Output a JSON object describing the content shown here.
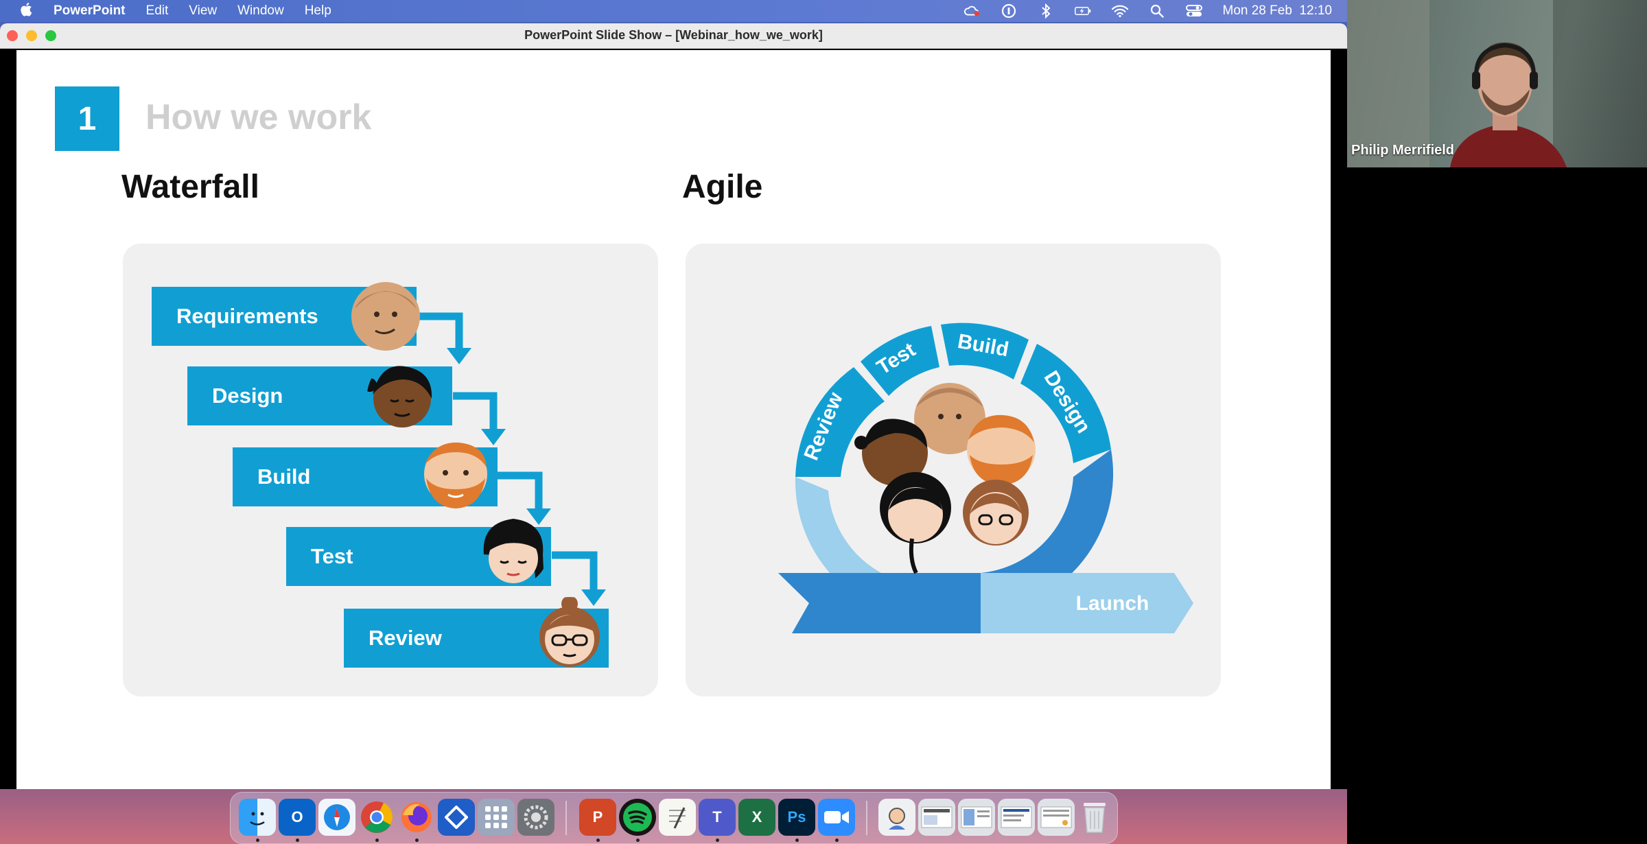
{
  "menubar": {
    "app_name": "PowerPoint",
    "menus": [
      "Edit",
      "View",
      "Window",
      "Help"
    ],
    "clock": "Mon 28 Feb  12:10",
    "status_icons": [
      "creative-cloud-icon",
      "1password-icon",
      "bluetooth-icon",
      "battery-icon",
      "wifi-icon",
      "search-icon",
      "control-center-icon"
    ]
  },
  "window": {
    "title": "PowerPoint Slide Show – [Webinar_how_we_work]"
  },
  "slide": {
    "section_number": "1",
    "title": "How we work",
    "waterfall": {
      "heading": "Waterfall",
      "steps": [
        "Requirements",
        "Design",
        "Build",
        "Test",
        "Review"
      ]
    },
    "agile": {
      "heading": "Agile",
      "cycle": [
        "Review",
        "Test",
        "Build",
        "Design"
      ],
      "launch": "Launch"
    }
  },
  "video": {
    "participant_name": "Philip Merrifield"
  },
  "dock": {
    "apps": [
      "finder-icon",
      "outlook-icon",
      "safari-icon",
      "chrome-icon",
      "firefox-icon",
      "jira-icon",
      "launchpad-icon",
      "system-preferences-icon",
      "powerpoint-icon",
      "spotify-icon",
      "textedit-icon",
      "teams-icon",
      "excel-icon",
      "photoshop-icon",
      "zoom-icon",
      "preview-icon",
      "document-thumbnail-icon",
      "document-thumbnail-icon",
      "document-thumbnail-icon",
      "document-thumbnail-icon",
      "trash-icon"
    ],
    "colors": {
      "outlook": "#0a64c8",
      "powerpoint": "#d24726",
      "excel": "#1d7044",
      "teams": "#5059c9",
      "photoshop": "#001e36",
      "zoom": "#2d8cff",
      "spotify": "#1db954"
    }
  },
  "theme": {
    "accent": "#119fd3",
    "accent_light": "#9cd0ec"
  }
}
